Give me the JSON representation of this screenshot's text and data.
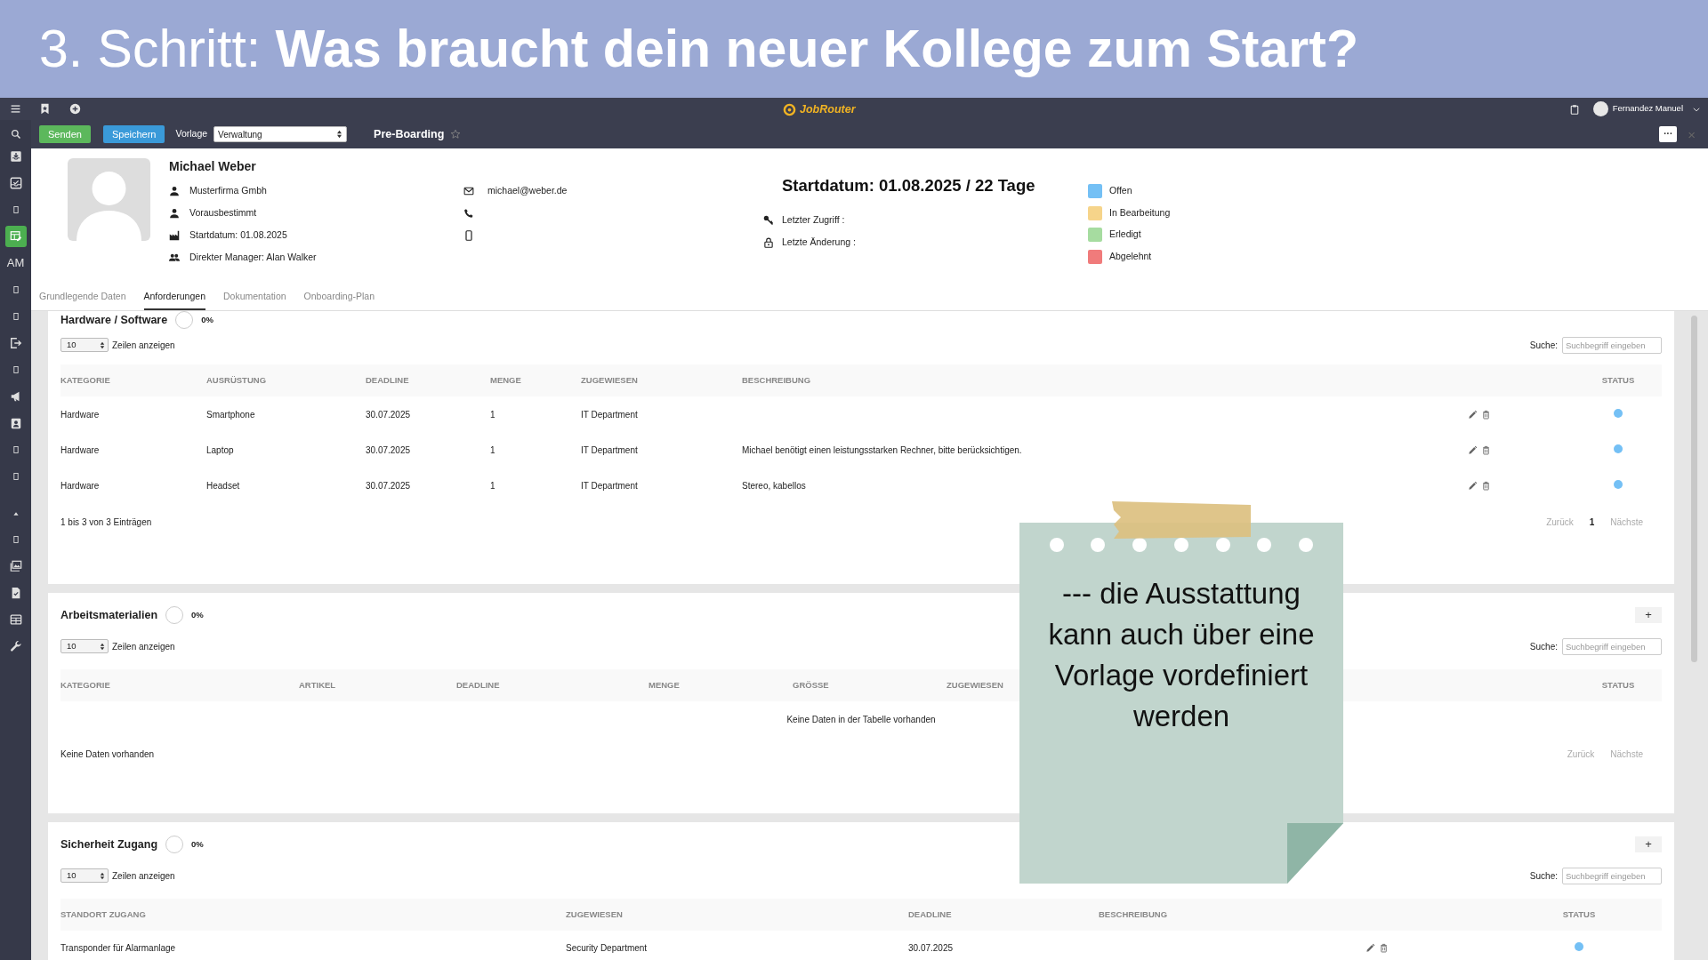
{
  "banner": {
    "title": "3. Schritt: **Was braucht dein neuer Kollege zum Start?**"
  },
  "topbar": {
    "logo": "JobRouter",
    "user": "Fernandez Manuel"
  },
  "toolbar": {
    "buttons": [
      {
        "label": "Senden",
        "kind": "success"
      },
      {
        "label": "Speichern",
        "kind": "primary"
      }
    ],
    "template_label": "Vorlage",
    "template_value": "Verwaltung",
    "title": "Pre-Boarding",
    "more": "···",
    "close": "×"
  },
  "sidebar": {
    "items": [
      {
        "kind": "icon",
        "selected": false
      },
      {
        "kind": "icon",
        "selected": false
      },
      {
        "kind": "icon",
        "selected": false
      },
      {
        "kind": "icon",
        "selected": true
      },
      {
        "kind": "text",
        "text": "AM",
        "selected": false
      },
      {
        "kind": "icon",
        "selected": false
      },
      {
        "kind": "icon",
        "selected": false
      },
      {
        "kind": "icon",
        "selected": false
      },
      {
        "kind": "icon",
        "selected": false
      },
      {
        "kind": "icon",
        "selected": false
      },
      {
        "kind": "icon",
        "selected": false
      },
      {
        "kind": "icon",
        "selected": false
      },
      {
        "kind": "icon",
        "selected": false
      },
      {
        "kind": "icon",
        "selected": false
      },
      {
        "kind": "icon",
        "selected": false
      },
      {
        "kind": "icon",
        "selected": false
      },
      {
        "kind": "icon",
        "selected": false
      },
      {
        "kind": "icon",
        "selected": false
      },
      {
        "kind": "icon",
        "selected": false
      }
    ]
  },
  "profile": {
    "name": "Michael Weber",
    "details": [
      "Musterfirma Gmbh",
      "Vorausbestimmt",
      "Startdatum: 01.08.2025",
      "Direkter Manager: Alan Walker"
    ],
    "email": "michael@weber.de"
  },
  "start": {
    "heading": "Startdatum: 01.08.2025 / 22 Tage",
    "fields": [
      "Letzter Zugriff :",
      "Letzte Änderung :"
    ]
  },
  "legend": [
    {
      "label": "Offen",
      "color": "#74c0f5"
    },
    {
      "label": "In Bearbeitung",
      "color": "#f6d48a"
    },
    {
      "label": "Erledigt",
      "color": "#a6dca0"
    },
    {
      "label": "Abgelehnt",
      "color": "#f07b7b"
    }
  ],
  "tabs": [
    {
      "label": "Grundlegende Daten",
      "selected": false
    },
    {
      "label": "Anforderungen",
      "selected": true
    },
    {
      "label": "Dokumentation",
      "selected": false
    },
    {
      "label": "Onboarding-Plan",
      "selected": false
    }
  ],
  "sections": [
    {
      "title": "Hardware / Software",
      "percent": "0%",
      "page_length": "10",
      "length_label": "Zeilen anzeigen",
      "search_label": "Suche:",
      "search_placeholder": "Suchbegriff eingeben",
      "columns": [
        "KATEGORIE",
        "AUSRÜSTUNG",
        "DEADLINE",
        "MENGE",
        "ZUGEWIESEN",
        "BESCHREIBUNG",
        "STATUS"
      ],
      "rows": [
        {
          "cells": [
            "Hardware",
            "Smartphone",
            "30.07.2025",
            "1",
            "IT Department"
          ],
          "color": "#74c0f5"
        },
        {
          "cells": [
            "Hardware",
            "Laptop",
            "30.07.2025",
            "1",
            "IT Department",
            "Michael benötigt einen leistungsstarken Rechner, bitte berücksichtigen."
          ],
          "color": "#74c0f5"
        },
        {
          "cells": [
            "Hardware",
            "Headset",
            "30.07.2025",
            "1",
            "IT Department",
            "Stereo, kabellos"
          ],
          "color": "#74c0f5"
        }
      ],
      "info": "1 bis 3 von 3 Einträgen",
      "pager": {
        "prev": "Zurück",
        "pages": [
          "1"
        ],
        "next": "Nächste"
      }
    },
    {
      "title": "Arbeitsmaterialien",
      "percent": "0%",
      "add_button": "+",
      "page_length": "10",
      "length_label": "Zeilen anzeigen",
      "search_label": "Suche:",
      "search_placeholder": "Suchbegriff eingeben",
      "columns": [
        "KATEGORIE",
        "ARTIKEL",
        "DEADLINE",
        "MENGE",
        "GRÖSSE",
        "ZUGEWIESEN",
        "STATUS"
      ],
      "empty_message": "Keine Daten in der Tabelle vorhanden",
      "info": "Keine Daten vorhanden",
      "pager": {
        "prev": "Zurück",
        "next": "Nächste"
      }
    },
    {
      "title": "Sicherheit Zugang",
      "percent": "0%",
      "add_button": "+",
      "page_length": "10",
      "length_label": "Zeilen anzeigen",
      "search_label": "Suche:",
      "search_placeholder": "Suchbegriff eingeben",
      "columns": [
        "STANDORT ZUGANG",
        "ZUGEWIESEN",
        "DEADLINE",
        "BESCHREIBUNG",
        "STATUS"
      ],
      "rows": [
        {
          "cells": [
            "Transponder für Alarmanlage",
            "Security Department",
            "30.07.2025"
          ],
          "color": "#74c0f5"
        }
      ]
    }
  ],
  "sticky_note": {
    "text": "--- die Ausstattung kann auch über eine Vorlage vordefiniert werden"
  }
}
